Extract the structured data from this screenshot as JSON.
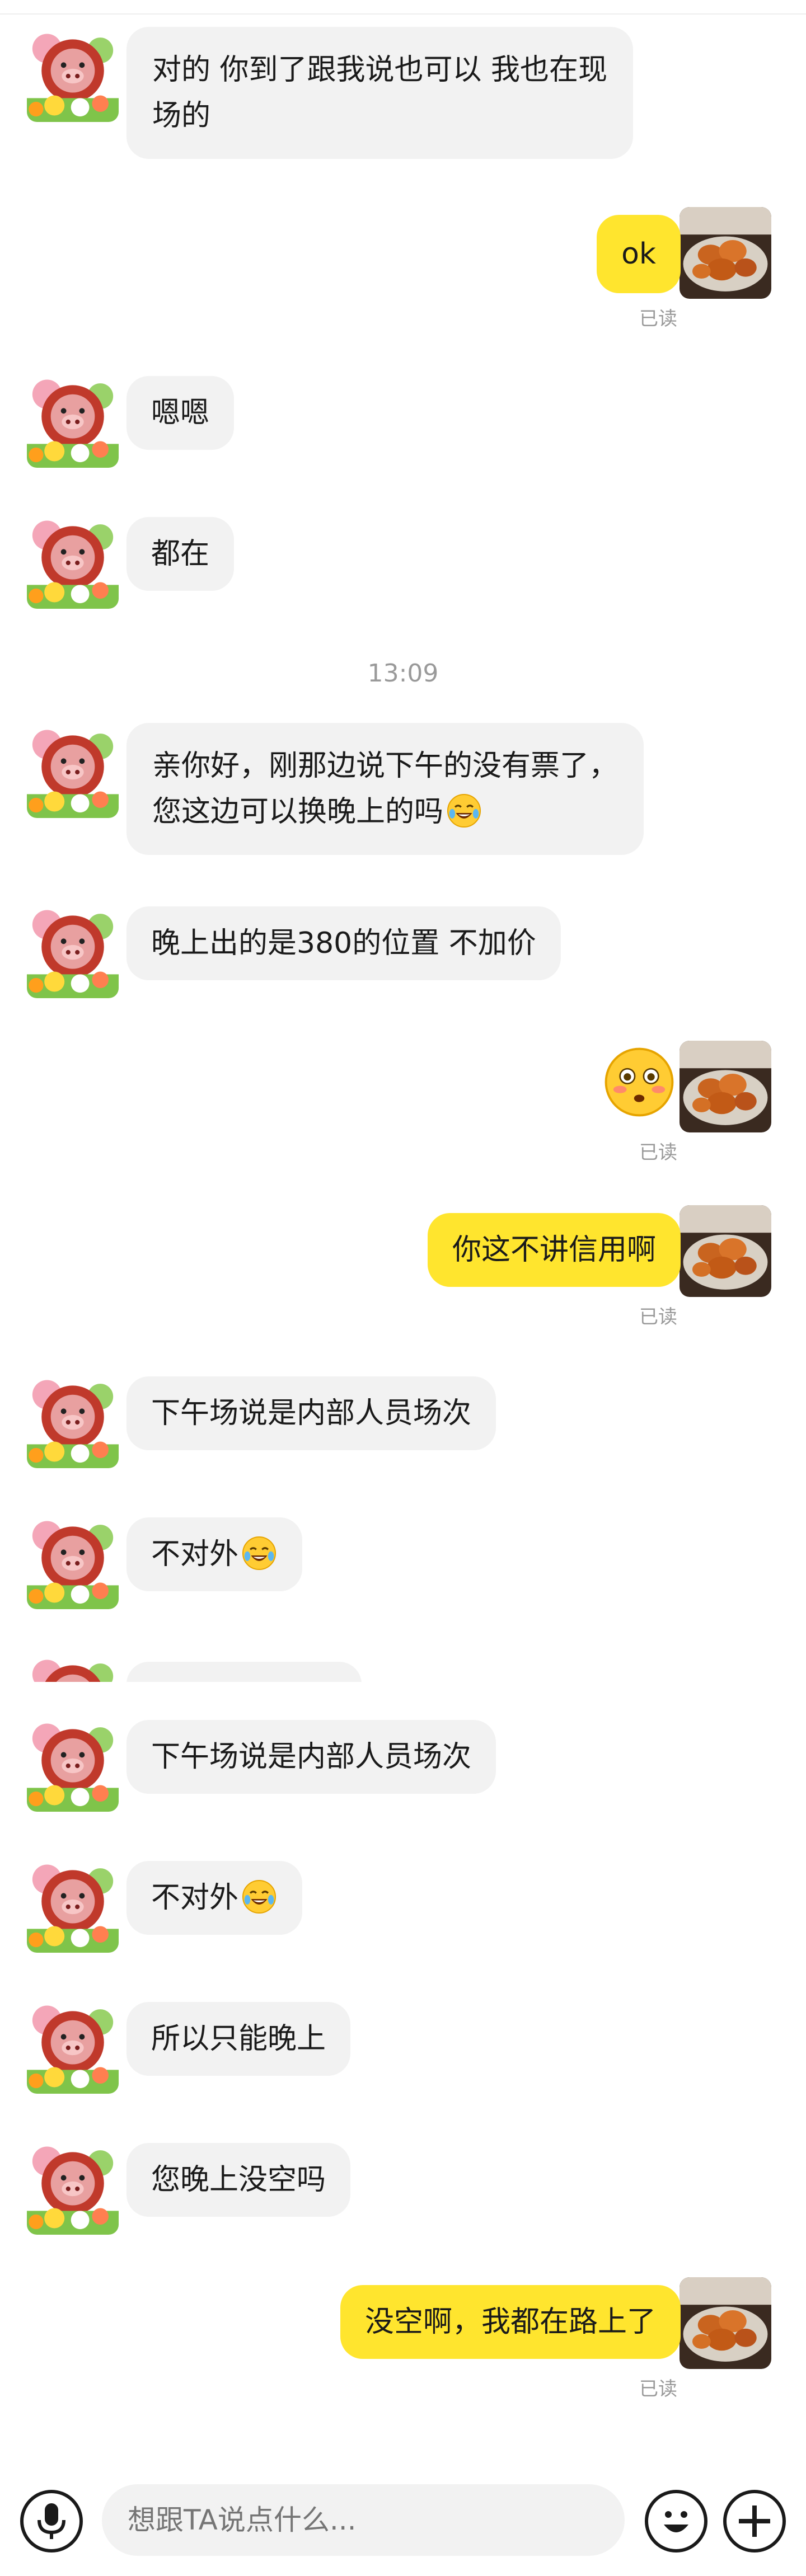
{
  "messages": [
    {
      "text1": "对的 你到了跟我说也可以 我也在现",
      "text2": "场的"
    },
    {
      "text": "ok",
      "status": "已读"
    },
    {
      "text": "嗯嗯"
    },
    {
      "text": "都在"
    },
    {
      "time": "13:09"
    },
    {
      "text1": "亲你好，刚那边说下午的没有票了，",
      "text2": "您这边可以换晚上的吗"
    },
    {
      "text": "晚上出的是380的位置 不加价"
    },
    {
      "status": "已读"
    },
    {
      "text": "你这不讲信用啊",
      "status": "已读"
    },
    {
      "text": "下午场说是内部人员场次"
    },
    {
      "text": "不对外"
    },
    {
      "text": "下午场说是内部人员场次"
    },
    {
      "text": "不对外"
    },
    {
      "text": "所以只能晚上"
    },
    {
      "text": "您晚上没空吗"
    },
    {
      "text": "没空啊，我都在路上了",
      "status": "已读"
    }
  ],
  "input": {
    "placeholder": "想跟TA说点什么..."
  },
  "icons": {
    "mic": "microphone-icon",
    "emoji": "emoji-icon",
    "plus": "plus-icon",
    "flushed": "flushed-face-emoji",
    "cry_laugh": "crying-laughing-emoji"
  },
  "colors": {
    "outgoing_bubble": "#ffe52e",
    "incoming_bubble": "#f2f2f2",
    "status_text": "#9a9a9a"
  }
}
